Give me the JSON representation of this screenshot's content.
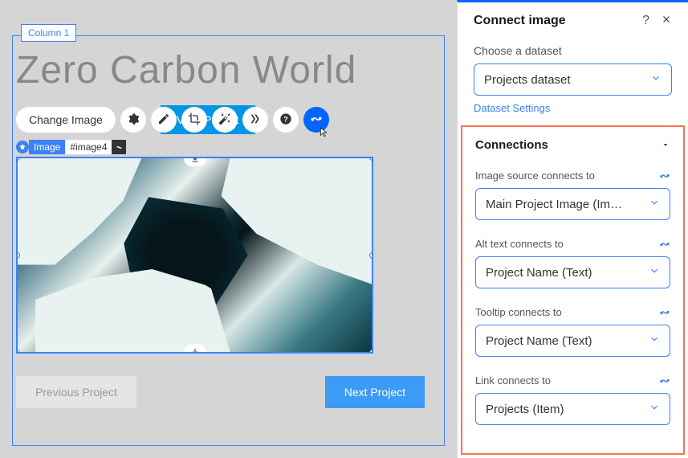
{
  "canvas": {
    "column_tag": "Column 1",
    "hero_title": "Zero Carbon World",
    "change_image_label": "Change Image",
    "hidden_button": "View Project",
    "selection": {
      "type": "Image",
      "id": "#image4"
    },
    "nav": {
      "prev": "Previous Project",
      "next": "Next Project"
    }
  },
  "panel": {
    "title": "Connect image",
    "dataset_label": "Choose a dataset",
    "dataset_value": "Projects dataset",
    "dataset_settings": "Dataset Settings",
    "connections_title": "Connections",
    "fields": [
      {
        "label": "Image source connects to",
        "value": "Main Project Image (Im…"
      },
      {
        "label": "Alt text connects to",
        "value": "Project Name (Text)"
      },
      {
        "label": "Tooltip connects to",
        "value": "Project Name (Text)"
      },
      {
        "label": "Link connects to",
        "value": "Projects (Item)"
      }
    ]
  }
}
